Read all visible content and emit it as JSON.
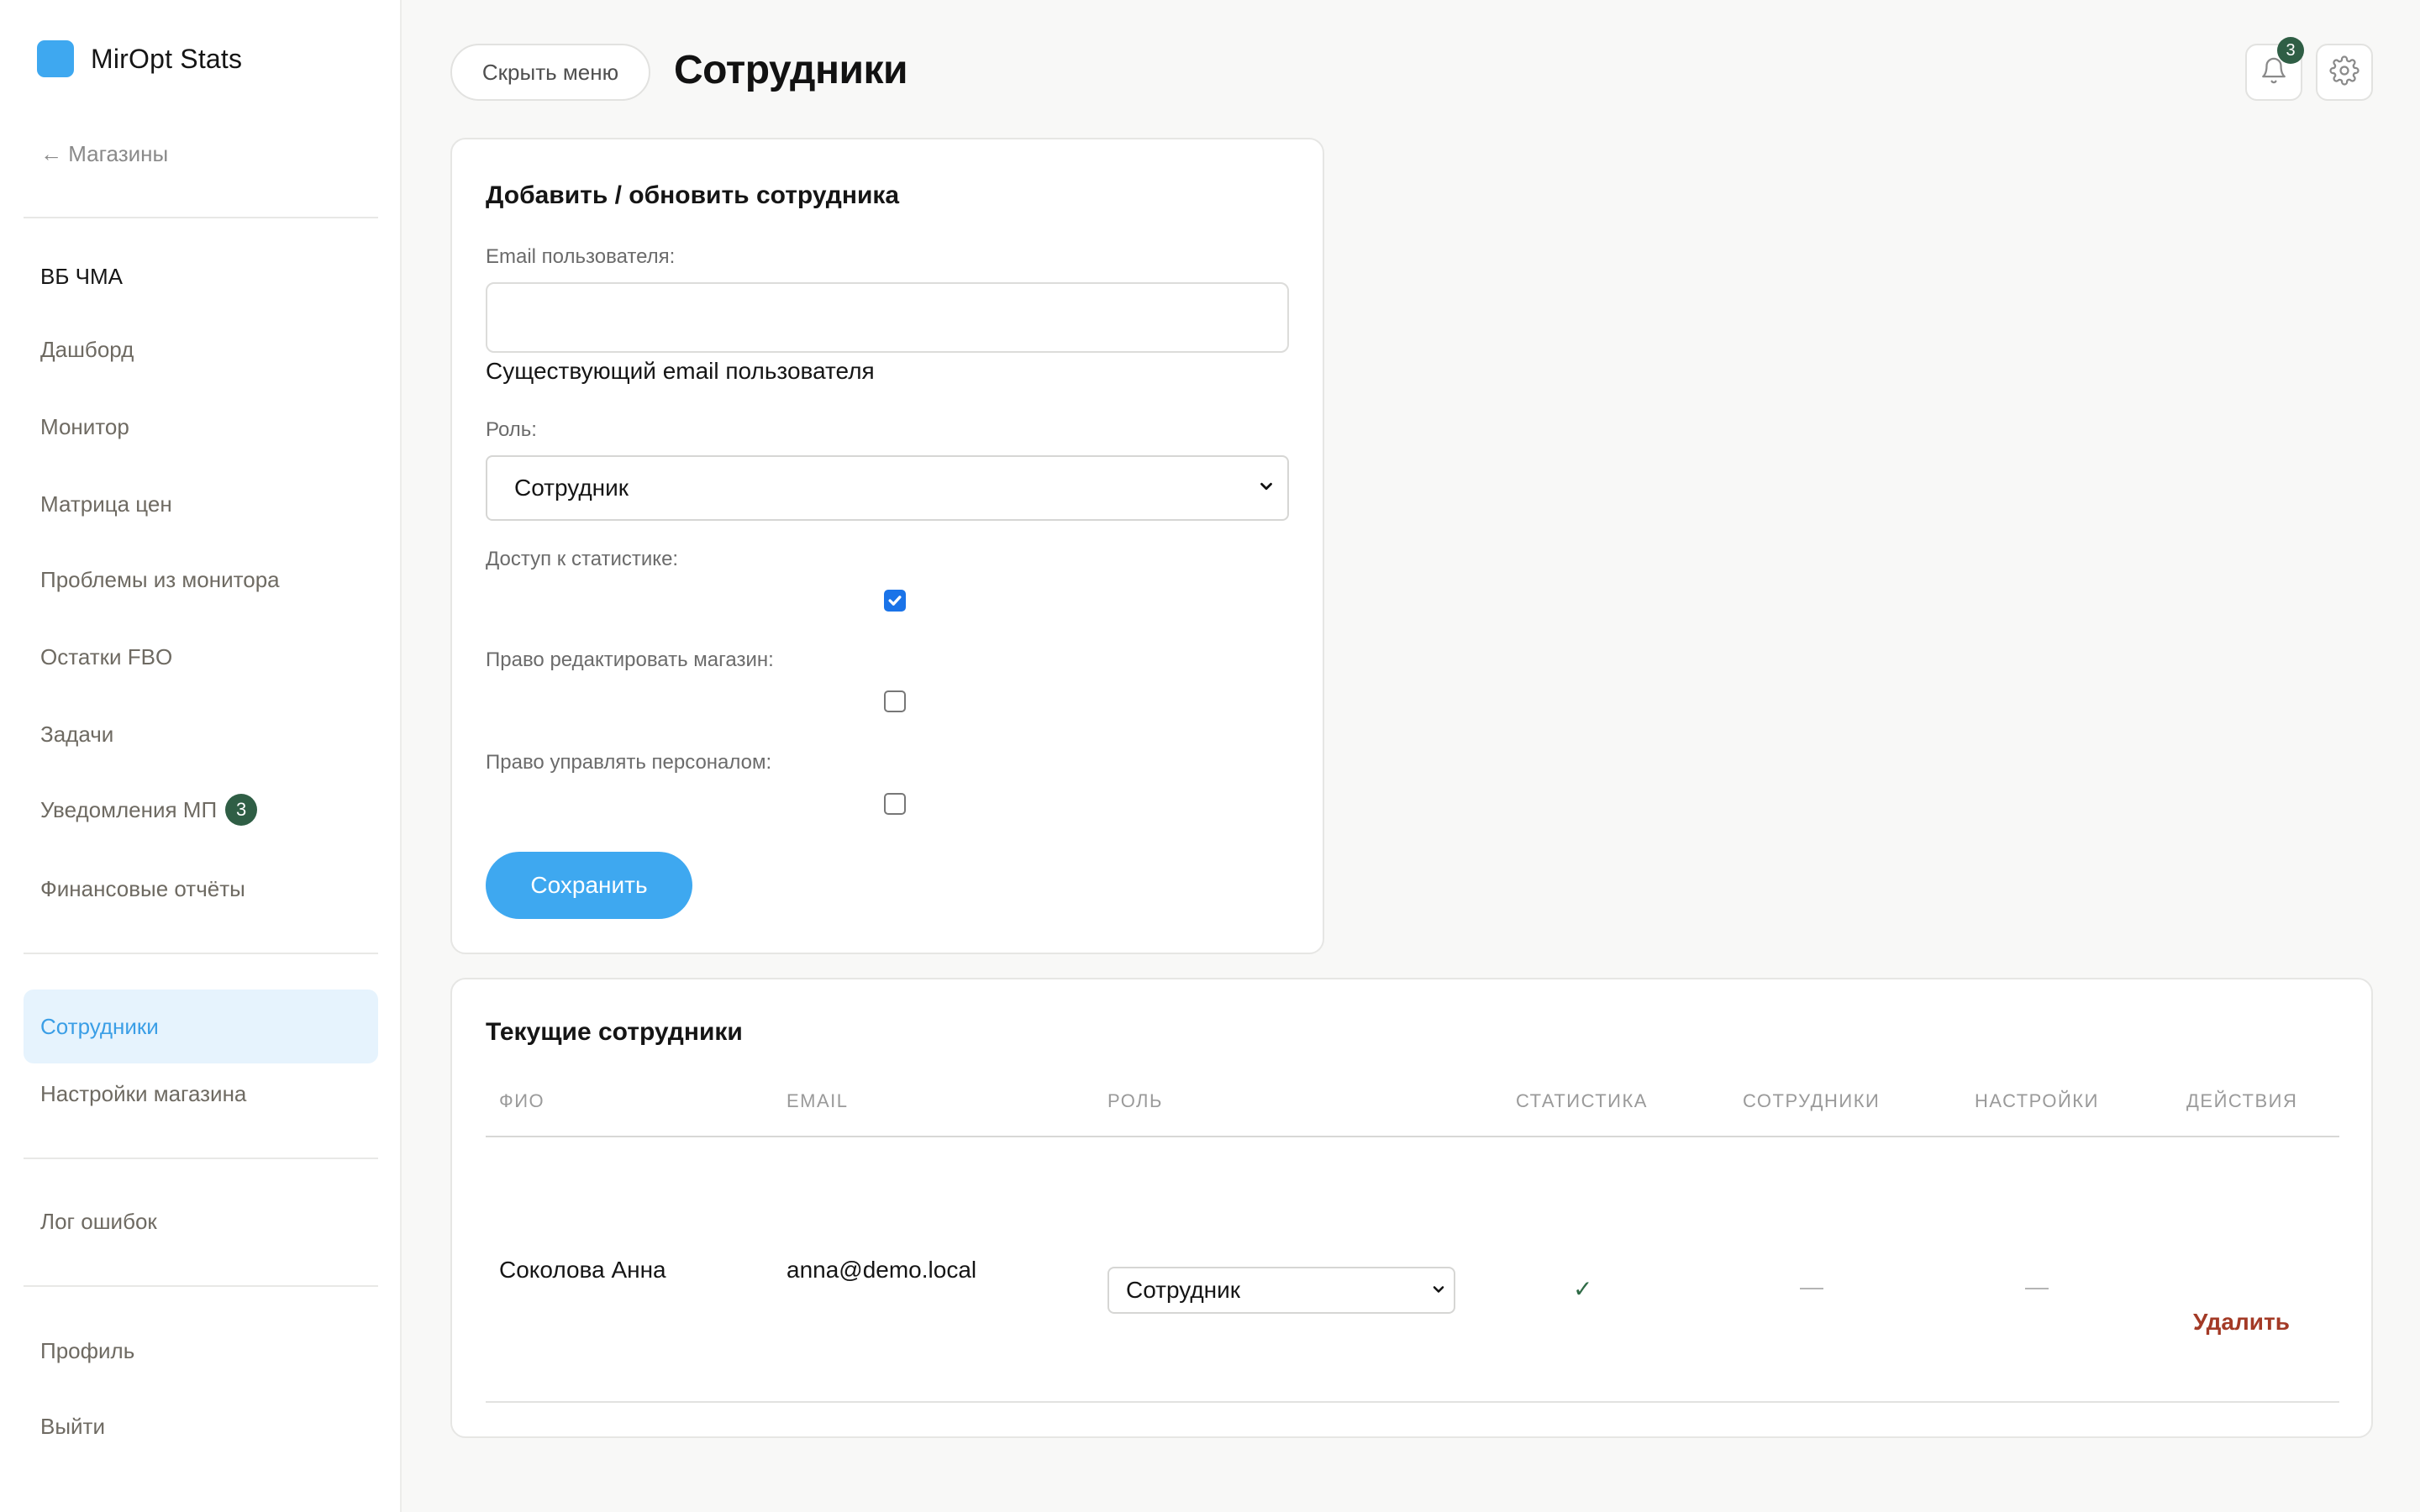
{
  "app": {
    "name": "MirOpt Stats"
  },
  "sidebar": {
    "back_label": "← Магазины",
    "store_name": "ВБ ЧМА",
    "items": [
      {
        "label": "Дашборд"
      },
      {
        "label": "Монитор"
      },
      {
        "label": "Матрица цен"
      },
      {
        "label": "Проблемы из монитора"
      },
      {
        "label": "Остатки FBO"
      },
      {
        "label": "Задачи"
      },
      {
        "label": "Уведомления МП",
        "badge": "3"
      },
      {
        "label": "Финансовые отчёты"
      }
    ],
    "staff_items": [
      {
        "label": "Сотрудники",
        "active": true
      },
      {
        "label": "Настройки магазина"
      }
    ],
    "error_log_label": "Лог ошибок",
    "profile_label": "Профиль",
    "logout_label": "Выйти"
  },
  "header": {
    "hide_menu_label": "Скрыть меню",
    "title": "Сотрудники",
    "notifications_count": "3"
  },
  "form": {
    "title": "Добавить / обновить сотрудника",
    "email_label": "Email пользователя:",
    "email_value": "",
    "email_hint": "Существующий email пользователя",
    "role_label": "Роль:",
    "role_value": "Сотрудник",
    "stats_access_label": "Доступ к статистике:",
    "stats_access_checked": true,
    "edit_store_label": "Право редактировать магазин:",
    "edit_store_checked": false,
    "manage_staff_label": "Право управлять персоналом:",
    "manage_staff_checked": false,
    "save_label": "Сохранить"
  },
  "table": {
    "title": "Текущие сотрудники",
    "columns": [
      "ФИО",
      "EMAIL",
      "РОЛЬ",
      "СТАТИСТИКА",
      "СОТРУДНИКИ",
      "НАСТРОЙКИ",
      "ДЕЙСТВИЯ"
    ],
    "rows": [
      {
        "name": "Соколова Анна",
        "email": "anna@demo.local",
        "role": "Сотрудник",
        "stats": "✓",
        "staff": "—",
        "settings": "—",
        "action": "Удалить"
      }
    ]
  },
  "colors": {
    "accent": "#3ea8f0",
    "badge": "#2f5e45",
    "danger": "#a33a26",
    "active_bg": "#e6f3fd"
  }
}
